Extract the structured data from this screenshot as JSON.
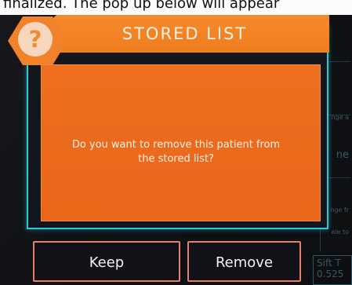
{
  "caption": {
    "text": "finalized. The pop up below will appear"
  },
  "dialog": {
    "title": "STORED LIST",
    "help_symbol": "?",
    "message": "Do you want to remove this patient from the stored list?",
    "buttons": {
      "keep": "Keep",
      "remove": "Remove"
    }
  },
  "background_ui": {
    "side_text_1": "nge a",
    "side_text_2": "ne",
    "side_text_3": "nge fr",
    "side_text_4": "ale to",
    "side_bottom_1": "Sift T",
    "side_bottom_2": "0.525"
  },
  "colors": {
    "accent_orange": "#ef7d20",
    "accent_cyan": "#28c9d9",
    "button_border": "#e57f6b"
  }
}
